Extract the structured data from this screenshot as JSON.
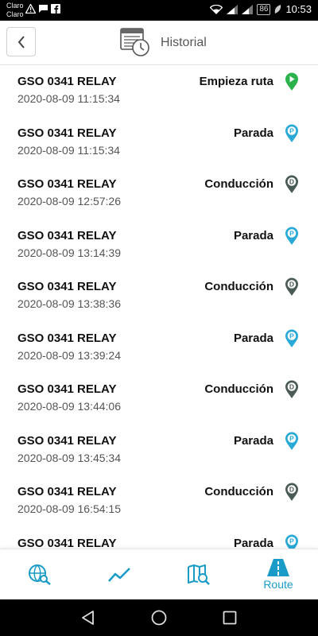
{
  "status_bar": {
    "carrier_line1": "Claro",
    "carrier_line2": "Claro",
    "battery": "86",
    "time": "10:53"
  },
  "header": {
    "title": "Historial",
    "back_icon": "chevron-left-icon",
    "title_icon": "calendar-clock-icon"
  },
  "colors": {
    "accent": "#1a9bc7",
    "start_green": "#2bb24c",
    "stop_blue": "#29a9d6",
    "drive_dark": "#4a5a55"
  },
  "events": [
    {
      "vehicle": "GSO 0341 RELAY",
      "timestamp": "2020-08-09 11:15:34",
      "event": "Empieza ruta",
      "type": "start",
      "badge": ""
    },
    {
      "vehicle": "GSO 0341 RELAY",
      "timestamp": "2020-08-09 11:15:34",
      "event": "Parada",
      "type": "stop",
      "badge": "P"
    },
    {
      "vehicle": "GSO 0341 RELAY",
      "timestamp": "2020-08-09 12:57:26",
      "event": "Conducción",
      "type": "drive",
      "badge": "D"
    },
    {
      "vehicle": "GSO 0341 RELAY",
      "timestamp": "2020-08-09 13:14:39",
      "event": "Parada",
      "type": "stop",
      "badge": "P"
    },
    {
      "vehicle": "GSO 0341 RELAY",
      "timestamp": "2020-08-09 13:38:36",
      "event": "Conducción",
      "type": "drive",
      "badge": "D"
    },
    {
      "vehicle": "GSO 0341 RELAY",
      "timestamp": "2020-08-09 13:39:24",
      "event": "Parada",
      "type": "stop",
      "badge": "P"
    },
    {
      "vehicle": "GSO 0341 RELAY",
      "timestamp": "2020-08-09 13:44:06",
      "event": "Conducción",
      "type": "drive",
      "badge": "D"
    },
    {
      "vehicle": "GSO 0341 RELAY",
      "timestamp": "2020-08-09 13:45:34",
      "event": "Parada",
      "type": "stop",
      "badge": "P"
    },
    {
      "vehicle": "GSO 0341 RELAY",
      "timestamp": "2020-08-09 16:54:15",
      "event": "Conducción",
      "type": "drive",
      "badge": "D"
    },
    {
      "vehicle": "GSO 0341 RELAY",
      "timestamp": "",
      "event": "Parada",
      "type": "stop",
      "badge": "P"
    }
  ],
  "bottom_nav": {
    "items": [
      {
        "icon": "globe-search-icon",
        "label": ""
      },
      {
        "icon": "trend-line-icon",
        "label": ""
      },
      {
        "icon": "map-search-icon",
        "label": ""
      },
      {
        "icon": "road-icon",
        "label": "Route"
      }
    ]
  }
}
